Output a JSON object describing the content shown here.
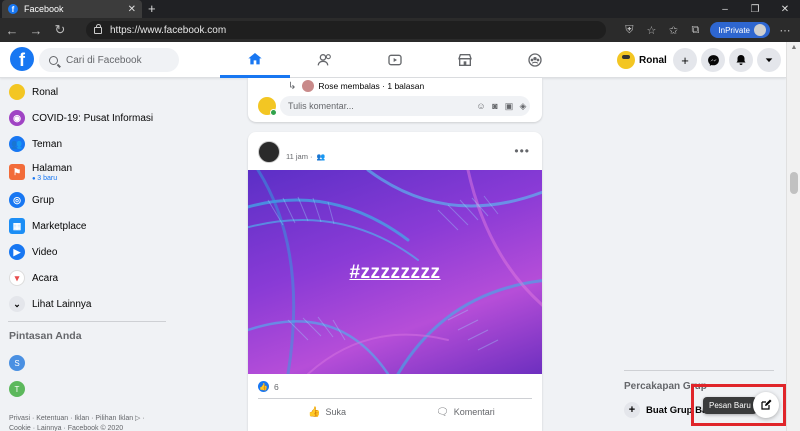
{
  "browser": {
    "tab_title": "Facebook",
    "tab_close": "✕",
    "new_tab": "+",
    "url": "https://www.facebook.com",
    "inprivate_label": "InPrivate"
  },
  "header": {
    "search_placeholder": "Cari di Facebook",
    "profile_name": "Ronal",
    "logo_letter": "f"
  },
  "sidebar": {
    "items": [
      {
        "label": "Ronal",
        "icon": "profile-avatar",
        "color": "#f3c623"
      },
      {
        "label": "COVID-19: Pusat Informasi",
        "icon": "covid-icon",
        "color": "#a044c4"
      },
      {
        "label": "Teman",
        "icon": "friends-icon",
        "color": "#1877f2"
      },
      {
        "label": "Halaman",
        "sub": "3 baru",
        "icon": "flag-icon",
        "color": "#f26c3a"
      },
      {
        "label": "Grup",
        "icon": "groups-icon",
        "color": "#1877f2"
      },
      {
        "label": "Marketplace",
        "icon": "marketplace-icon",
        "color": "#1c8ef5"
      },
      {
        "label": "Video",
        "icon": "video-icon",
        "color": "#1877f2"
      },
      {
        "label": "Acara",
        "icon": "events-icon",
        "color": "#e74c4c"
      },
      {
        "label": "Lihat Lainnya",
        "icon": "chevron-down-icon",
        "color": "#e4e6eb"
      }
    ],
    "shortcuts_title": "Pintasan Anda",
    "shortcuts": [
      {
        "letter": "S",
        "color": "#4a90e2"
      },
      {
        "letter": "T",
        "color": "#5cb85c"
      }
    ],
    "footer": "Privasi · Ketentuan · Iklan · Pilihan Iklan ▷ · Cookie · Lainnya · Facebook © 2020"
  },
  "feed": {
    "reply_text": "Rose membalas · 1 balasan",
    "comment_placeholder": "Tulis komentar...",
    "post": {
      "time": "11 jam",
      "hashtag": "#zzzzzzzz",
      "like_count": "6",
      "like_label": "Suka",
      "comment_label": "Komentari"
    }
  },
  "right": {
    "group_chats_title": "Percakapan Grup",
    "create_group_label": "Buat Grup Baru",
    "tooltip": "Pesan Baru"
  },
  "colors": {
    "fb_blue": "#1877f2",
    "highlight": "#e0252a"
  }
}
